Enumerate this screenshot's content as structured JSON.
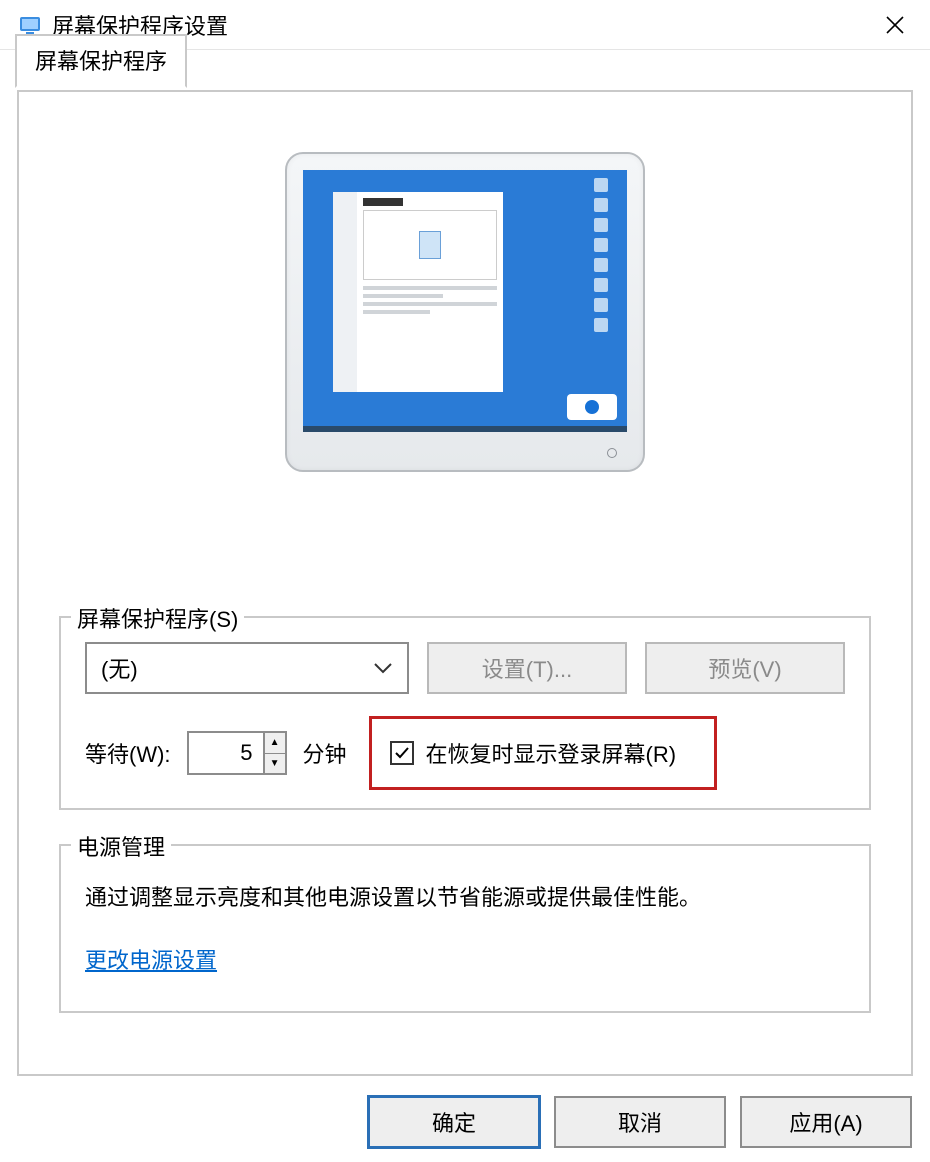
{
  "window": {
    "title": "屏幕保护程序设置"
  },
  "tab": {
    "label": "屏幕保护程序"
  },
  "screensaver_group": {
    "legend": "屏幕保护程序(S)",
    "selected": "(无)",
    "settings_btn": "设置(T)...",
    "preview_btn": "预览(V)",
    "wait_label": "等待(W):",
    "wait_value": "5",
    "wait_unit": "分钟",
    "resume_checkbox_label": "在恢复时显示登录屏幕(R)",
    "resume_checked": true
  },
  "power_group": {
    "legend": "电源管理",
    "description": "通过调整显示亮度和其他电源设置以节省能源或提供最佳性能。",
    "link": "更改电源设置"
  },
  "footer": {
    "ok": "确定",
    "cancel": "取消",
    "apply": "应用(A)"
  }
}
